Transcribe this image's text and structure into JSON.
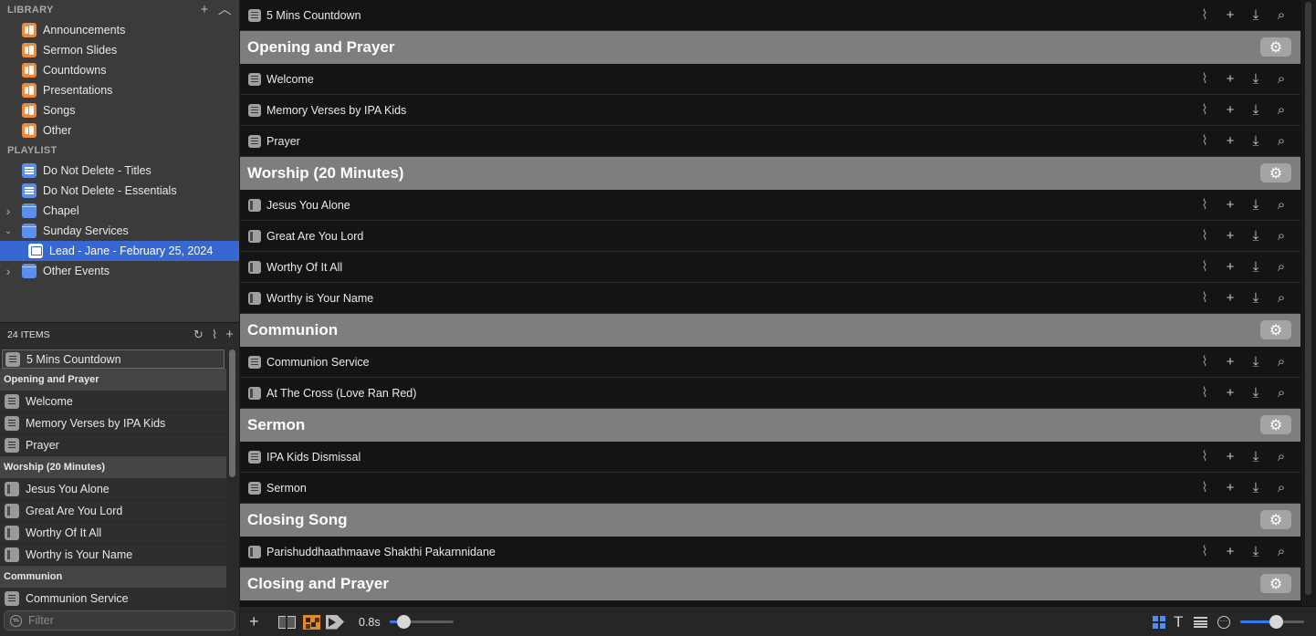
{
  "library": {
    "header": "LIBRARY",
    "add_icon": "+",
    "collapse_icon": "︿",
    "items": [
      {
        "label": "Announcements"
      },
      {
        "label": "Sermon Slides"
      },
      {
        "label": "Countdowns"
      },
      {
        "label": "Presentations"
      },
      {
        "label": "Songs"
      },
      {
        "label": "Other"
      }
    ]
  },
  "playlist": {
    "header": "PLAYLIST",
    "items": [
      {
        "label": "Do Not Delete - Titles",
        "type": "playlist"
      },
      {
        "label": "Do Not Delete - Essentials",
        "type": "playlist"
      },
      {
        "label": "Chapel",
        "type": "folder",
        "expanded": false
      },
      {
        "label": "Sunday Services",
        "type": "folder",
        "expanded": true
      },
      {
        "label": "Lead - Jane - February 25, 2024",
        "type": "service",
        "selected": true
      },
      {
        "label": "Other Events",
        "type": "folder",
        "expanded": false
      }
    ]
  },
  "items_pane": {
    "count_label": "24 ITEMS",
    "filter_placeholder": "Filter",
    "list": [
      {
        "kind": "item",
        "label": "5 Mins Countdown"
      },
      {
        "kind": "header",
        "label": "Opening and Prayer"
      },
      {
        "kind": "item",
        "label": "Welcome"
      },
      {
        "kind": "item",
        "label": "Memory Verses by IPA Kids"
      },
      {
        "kind": "item",
        "label": "Prayer"
      },
      {
        "kind": "header",
        "label": "Worship (20 Minutes)"
      },
      {
        "kind": "song",
        "label": "Jesus You Alone"
      },
      {
        "kind": "song",
        "label": "Great Are You Lord"
      },
      {
        "kind": "song",
        "label": "Worthy Of It All"
      },
      {
        "kind": "song",
        "label": "Worthy is Your Name"
      },
      {
        "kind": "header",
        "label": "Communion"
      },
      {
        "kind": "item",
        "label": "Communion Service"
      }
    ]
  },
  "main": {
    "rows": [
      {
        "kind": "item",
        "label": "5 Mins Countdown"
      },
      {
        "kind": "header",
        "label": "Opening and Prayer"
      },
      {
        "kind": "item",
        "label": "Welcome"
      },
      {
        "kind": "item",
        "label": "Memory Verses by IPA Kids"
      },
      {
        "kind": "item",
        "label": "Prayer"
      },
      {
        "kind": "header",
        "label": "Worship (20 Minutes)"
      },
      {
        "kind": "song",
        "label": "Jesus You Alone"
      },
      {
        "kind": "song",
        "label": "Great Are You Lord"
      },
      {
        "kind": "song",
        "label": "Worthy Of It All"
      },
      {
        "kind": "song",
        "label": "Worthy is Your Name"
      },
      {
        "kind": "header",
        "label": "Communion"
      },
      {
        "kind": "item",
        "label": "Communion Service"
      },
      {
        "kind": "song",
        "label": "At The Cross (Love Ran Red)"
      },
      {
        "kind": "header",
        "label": "Sermon"
      },
      {
        "kind": "item",
        "label": "IPA Kids Dismissal"
      },
      {
        "kind": "item",
        "label": "Sermon"
      },
      {
        "kind": "header",
        "label": "Closing Song"
      },
      {
        "kind": "song",
        "label": "Parishuddhaathmaave Shakthi Pakarnnidane"
      },
      {
        "kind": "header",
        "label": "Closing and Prayer"
      }
    ],
    "row_actions": [
      "paperclip-icon",
      "plus-icon",
      "download-icon",
      "search-icon"
    ],
    "header_action": "gear-icon"
  },
  "bottom_bar": {
    "add_label": "+",
    "transition_duration": "0.8s",
    "transition_slider_fraction": 0.22,
    "zoom_slider_fraction": 0.55,
    "text_view_glyph": "T"
  },
  "colors": {
    "accent": "#3767d0",
    "library_icon": "#ee8a3c",
    "playlist_icon": "#5a8ef0",
    "header_bg": "#7e7e7e",
    "slider_fill": "#3478f6"
  }
}
